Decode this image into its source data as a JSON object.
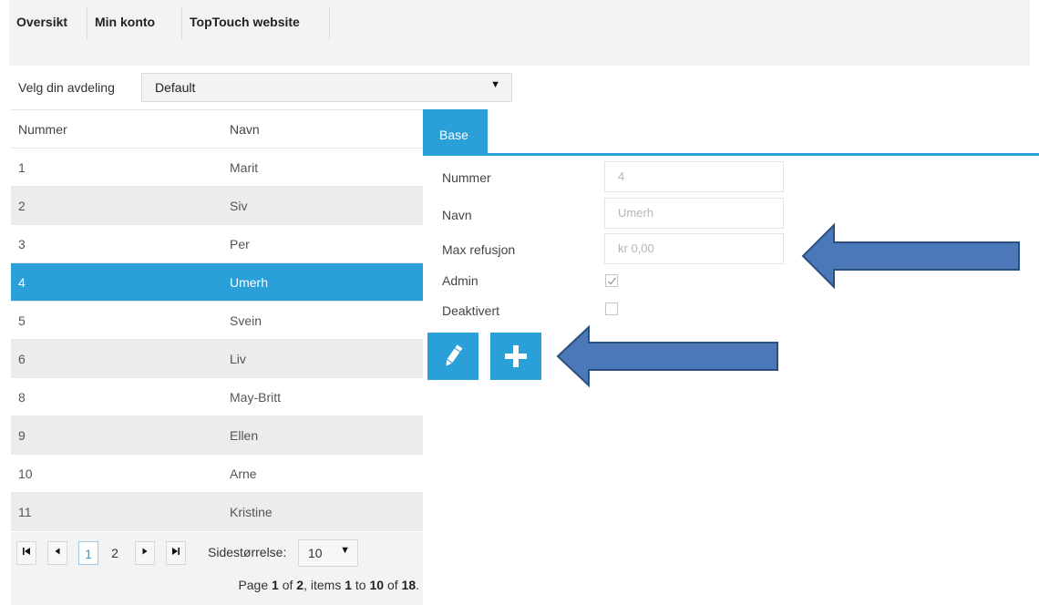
{
  "topnav": {
    "tabs": [
      {
        "label": "Oversikt"
      },
      {
        "label": "Min konto"
      },
      {
        "label": "TopTouch website"
      }
    ]
  },
  "department": {
    "label": "Velg din avdeling",
    "selected": "Default"
  },
  "grid": {
    "headers": [
      "Nummer",
      "Navn"
    ],
    "rows": [
      {
        "nummer": "1",
        "navn": "Marit"
      },
      {
        "nummer": "2",
        "navn": "Siv"
      },
      {
        "nummer": "3",
        "navn": "Per"
      },
      {
        "nummer": "4",
        "navn": "Umerh",
        "selected": true
      },
      {
        "nummer": "5",
        "navn": "Svein"
      },
      {
        "nummer": "6",
        "navn": "Liv"
      },
      {
        "nummer": "8",
        "navn": "May-Britt"
      },
      {
        "nummer": "9",
        "navn": "Ellen"
      },
      {
        "nummer": "10",
        "navn": "Arne"
      },
      {
        "nummer": "11",
        "navn": "Kristine"
      }
    ]
  },
  "pager": {
    "pages": [
      "1",
      "2"
    ],
    "current_page": "1",
    "page_size_label": "Sidestørrelse:",
    "page_size": "10",
    "info": {
      "page_prefix": "Page ",
      "page": "1",
      "of_text": " of ",
      "pages": "2",
      "items_text": ", items ",
      "from": "1",
      "to_text": " to ",
      "to": "10",
      "of2_text": " of ",
      "total": "18",
      "end": "."
    }
  },
  "detail": {
    "tab_label": "Base",
    "fields": {
      "nummer_label": "Nummer",
      "nummer_value": "4",
      "navn_label": "Navn",
      "navn_value": "Umerh",
      "refusjon_label": "Max refusjon",
      "refusjon_value": "kr 0,00",
      "admin_label": "Admin",
      "admin_checked": true,
      "deaktivert_label": "Deaktivert",
      "deaktivert_checked": false
    },
    "buttons": {
      "edit_icon": "pencil-icon",
      "add_icon": "plus-icon"
    }
  },
  "colors": {
    "accent": "#2a9fd8",
    "arrow_fill": "#4a78b8",
    "arrow_stroke": "#2b4f7e"
  }
}
